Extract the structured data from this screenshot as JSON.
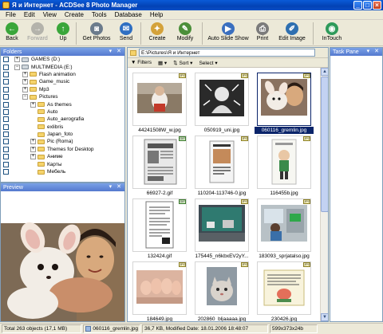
{
  "window": {
    "title": "Я и Интернет - ACDSee 8 Photo Manager"
  },
  "menu": [
    "File",
    "Edit",
    "View",
    "Create",
    "Tools",
    "Database",
    "Help"
  ],
  "toolbar": [
    {
      "label": "Back",
      "icon": "back-arrow-icon",
      "color": "#3aa63a",
      "enabled": true
    },
    {
      "label": "Forward",
      "icon": "forward-arrow-icon",
      "color": "#3aa63a",
      "enabled": false
    },
    {
      "label": "Up",
      "icon": "up-arrow-icon",
      "color": "#3aa63a",
      "enabled": true
    },
    {
      "label": "Get Photos",
      "icon": "camera-icon",
      "color": "#6b7b8c",
      "enabled": true
    },
    {
      "label": "Send",
      "icon": "send-icon",
      "color": "#2f6fc2",
      "enabled": true
    },
    {
      "label": "Create",
      "icon": "create-icon",
      "color": "#d4a23a",
      "enabled": true
    },
    {
      "label": "Modify",
      "icon": "modify-icon",
      "color": "#4b8f3a",
      "enabled": true
    },
    {
      "label": "Auto Slide Show",
      "icon": "slideshow-icon",
      "color": "#3a6fbf",
      "enabled": true
    },
    {
      "label": "Print",
      "icon": "printer-icon",
      "color": "#7b7b7b",
      "enabled": true
    },
    {
      "label": "Edit Image",
      "icon": "edit-image-icon",
      "color": "#2e6fb0",
      "enabled": true
    },
    {
      "label": "InTouch",
      "icon": "intouch-icon",
      "color": "#2e9a5a",
      "enabled": true
    }
  ],
  "folders_pane": {
    "title": "Folders",
    "tree": [
      {
        "label": "GAMES (D:)",
        "level": 0,
        "expander": "+",
        "kind": "drive"
      },
      {
        "label": "MULTIMEDIA (E:)",
        "level": 0,
        "expander": "−",
        "kind": "drive"
      },
      {
        "label": "Flash animation",
        "level": 1,
        "expander": "+",
        "kind": "folder"
      },
      {
        "label": "Game_music",
        "level": 1,
        "expander": "+",
        "kind": "folder"
      },
      {
        "label": "Mp3",
        "level": 1,
        "expander": "+",
        "kind": "folder"
      },
      {
        "label": "Pictures",
        "level": 1,
        "expander": "−",
        "kind": "folder"
      },
      {
        "label": "As themes",
        "level": 2,
        "expander": "+",
        "kind": "folder"
      },
      {
        "label": "Auto",
        "level": 2,
        "expander": "",
        "kind": "folder"
      },
      {
        "label": "Auto_aerografia",
        "level": 2,
        "expander": "",
        "kind": "folder"
      },
      {
        "label": "exlibris",
        "level": 2,
        "expander": "",
        "kind": "folder"
      },
      {
        "label": "Japan_foto",
        "level": 2,
        "expander": "",
        "kind": "folder"
      },
      {
        "label": "Pic (Roma)",
        "level": 2,
        "expander": "+",
        "kind": "folder"
      },
      {
        "label": "Themes for Desktop",
        "level": 2,
        "expander": "+",
        "kind": "folder"
      },
      {
        "label": "Аниме",
        "level": 2,
        "expander": "+",
        "kind": "folder"
      },
      {
        "label": "Карты",
        "level": 2,
        "expander": "",
        "kind": "folder"
      },
      {
        "label": "Мебель",
        "level": 2,
        "expander": "",
        "kind": "folder"
      }
    ]
  },
  "preview_pane": {
    "title": "Preview"
  },
  "task_pane": {
    "title": "Task Pane"
  },
  "main": {
    "path": "E:\\Pictures\\Я и Интернет",
    "filters_label": "Filters",
    "sort_label": "Sort",
    "select_label": "Select",
    "thumbnails": [
      {
        "name": "44241508W_w.jpg",
        "badge": "JPG",
        "selected": false,
        "art": "people-photo"
      },
      {
        "name": "050919_uni.jpg",
        "badge": "JPG",
        "selected": false,
        "art": "bw-figure"
      },
      {
        "name": "060116_gremlin.jpg",
        "badge": "JPG",
        "selected": true,
        "art": "fox-girl"
      },
      {
        "name": "66927-2.gif",
        "badge": "GIF",
        "selected": false,
        "art": "newspaper"
      },
      {
        "name": "110204-113746-0.jpg",
        "badge": "JPG",
        "selected": false,
        "art": "poster"
      },
      {
        "name": "116455b.jpg",
        "badge": "JPG",
        "selected": false,
        "art": "cartoon"
      },
      {
        "name": "132424.gif",
        "badge": "GIF",
        "selected": false,
        "art": "document"
      },
      {
        "name": "175445_n6kbxEV2yY...",
        "badge": "JPG",
        "selected": false,
        "art": "green-screen"
      },
      {
        "name": "183093_sprjatalso.jpg",
        "badge": "JPG",
        "selected": false,
        "art": "office"
      },
      {
        "name": "184649.jpg",
        "badge": "JPG",
        "selected": false,
        "art": "feet"
      },
      {
        "name": "202860_bljaaaaa.jpg",
        "badge": "JPG",
        "selected": false,
        "art": "cat"
      },
      {
        "name": "230426.jpg",
        "badge": "JPG",
        "selected": false,
        "art": "card"
      }
    ]
  },
  "status": {
    "total": "Total 263 objects  (17,1 MB)",
    "file": "060116_gremlin.jpg",
    "info": "36,7 KB, Modified Date: 18.01.2006 18:48:07",
    "dims": "599x373x24b"
  }
}
